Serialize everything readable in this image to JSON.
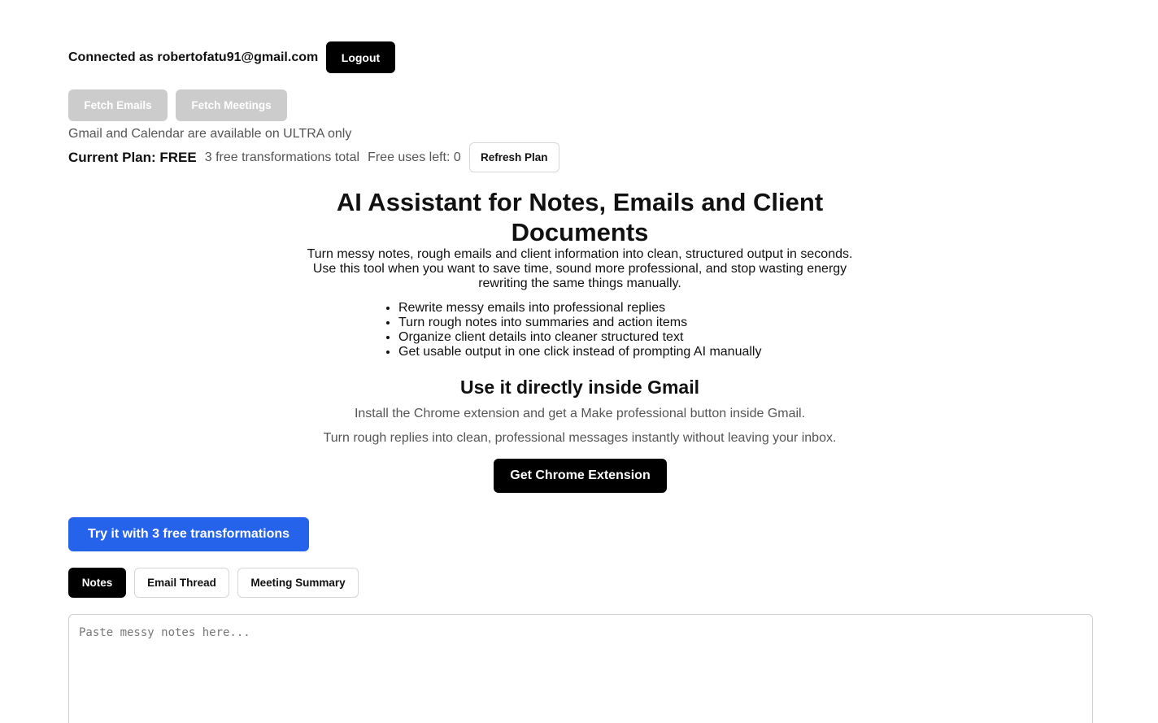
{
  "account": {
    "connected_text": "Connected as robertofatu91@gmail.com",
    "logout_label": "Logout"
  },
  "fetch": {
    "emails_label": "Fetch Emails",
    "meetings_label": "Fetch Meetings",
    "availability_note": "Gmail and Calendar are available on ULTRA only"
  },
  "plan": {
    "label": "Current Plan: FREE",
    "total_text": "3 free transformations total",
    "uses_left_text": "Free uses left: 0",
    "refresh_label": "Refresh Plan"
  },
  "hero": {
    "title": "AI Assistant for Notes, Emails and Client Documents",
    "description_line_1": "Turn messy notes, rough emails and client information into clean, structured output in seconds.",
    "description_line_2": "Use this tool when you want to save time, sound more professional, and stop wasting energy rewriting the same things manually.",
    "bullets": [
      "Rewrite messy emails into professional replies",
      "Turn rough notes into summaries and action items",
      "Organize client details into cleaner structured text",
      "Get usable output in one click instead of prompting AI manually"
    ]
  },
  "gmail": {
    "title": "Use it directly inside Gmail",
    "line_1": "Install the Chrome extension and get a Make professional button inside Gmail.",
    "line_2": "Turn rough replies into clean, professional messages instantly without leaving your inbox.",
    "extension_button_label": "Get Chrome Extension"
  },
  "trial": {
    "button_label": "Try it with 3 free transformations"
  },
  "tabs": [
    {
      "label": "Notes",
      "active": true
    },
    {
      "label": "Email Thread",
      "active": false
    },
    {
      "label": "Meeting Summary",
      "active": false
    }
  ],
  "editor": {
    "placeholder": "Paste messy notes here...",
    "value": ""
  },
  "colors": {
    "primary_dark": "#000000",
    "accent_blue": "#2563eb",
    "disabled_gray": "#cccccc",
    "muted_text": "#555555"
  }
}
